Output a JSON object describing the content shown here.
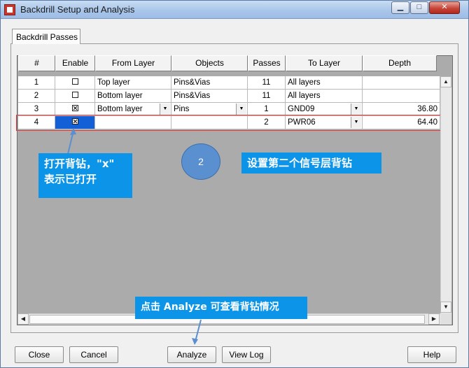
{
  "window": {
    "title": "Backdrill Setup and Analysis"
  },
  "titlebar_buttons": {
    "minimize": "▁",
    "maximize": "□",
    "close": "✕"
  },
  "tab": {
    "label": "Backdrill Passes"
  },
  "grid": {
    "headers": [
      "#",
      "Enable",
      "From Layer",
      "Objects",
      "Passes",
      "To Layer",
      "Depth"
    ],
    "rows": [
      {
        "num": "1",
        "enabled": false,
        "from": "Top layer",
        "objects": "Pins&Vias",
        "passes": "11",
        "to": "All layers",
        "depth": ""
      },
      {
        "num": "2",
        "enabled": false,
        "from": "Bottom layer",
        "objects": "Pins&Vias",
        "passes": "11",
        "to": "All layers",
        "depth": ""
      },
      {
        "num": "3",
        "enabled": true,
        "from": "Bottom layer",
        "objects": "Pins",
        "passes": "1",
        "to": "GND09",
        "depth": "36.80"
      },
      {
        "num": "4",
        "enabled": true,
        "from": "",
        "objects": "",
        "passes": "2",
        "to": "PWR06",
        "depth": "64.40"
      }
    ]
  },
  "annotations": {
    "note_enable_line1": "打开背钻，\"x\"",
    "note_enable_line2": "表示已打开",
    "circle_number": "2",
    "note_second_layer": "设置第二个信号层背钻",
    "note_analyze": "点击 Analyze 可查看背钻情况"
  },
  "buttons": {
    "close": "Close",
    "cancel": "Cancel",
    "analyze": "Analyze",
    "view_log": "View Log",
    "help": "Help"
  },
  "colors": {
    "accent_blue": "#0b94e8",
    "selection": "#1360d6",
    "highlight_red": "#e23a3a"
  }
}
